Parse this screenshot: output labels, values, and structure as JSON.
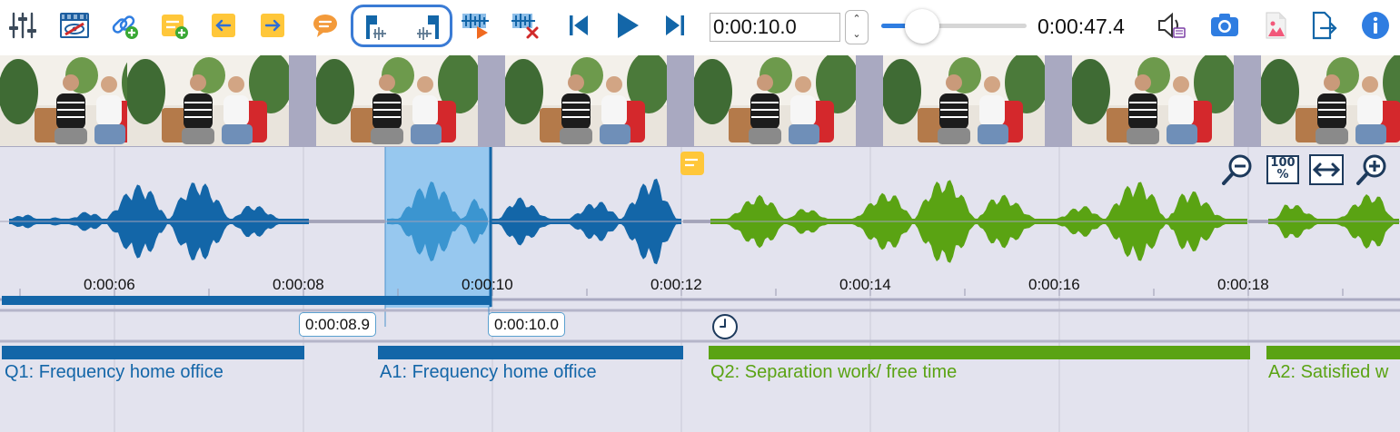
{
  "toolbar": {
    "current_time": "0:00:10.0",
    "total_time": "0:00:47.4",
    "volume_fraction": 0.28,
    "icons": [
      "settings-sliders-icon",
      "video-icon",
      "add-link-icon",
      "new-memo-icon",
      "previous-memo-icon",
      "next-memo-icon",
      "comment-icon",
      "range-markers-icon",
      "play-selection-icon",
      "remove-selection-icon",
      "skip-back-icon",
      "play-icon",
      "skip-forward-icon",
      "speaker-icon",
      "camera-icon",
      "export-image-icon",
      "export-icon",
      "info-icon"
    ]
  },
  "colors": {
    "blue": "#1366a8",
    "green": "#5aa313",
    "selection": "#89c3ee",
    "memo": "#ffc73a"
  },
  "timeline": {
    "ticks": [
      "0:00:06",
      "0:00:08",
      "0:00:10",
      "0:00:12",
      "0:00:14",
      "0:00:16",
      "0:00:18"
    ],
    "selection_start": "0:00:08.9",
    "selection_end": "0:00:10.0"
  },
  "segments": [
    {
      "label": "Q1: Frequency home office",
      "color": "#1366a8"
    },
    {
      "label": "A1: Frequency home office",
      "color": "#1366a8"
    },
    {
      "label": "Q2: Separation work/ free time",
      "color": "#5aa313"
    },
    {
      "label": "A2: Satisfied w",
      "color": "#5aa313"
    }
  ],
  "zoom": {
    "reset_label": "100"
  }
}
